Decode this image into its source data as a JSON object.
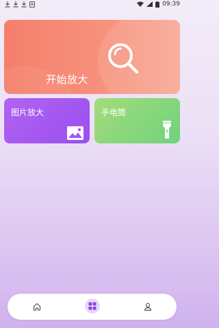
{
  "status_bar": {
    "time": "09:39",
    "icons": [
      "download-icon",
      "download-icon",
      "download-icon",
      "app-notification-icon"
    ]
  },
  "cards": {
    "start_zoom": {
      "label": "开始放大",
      "icon": "magnifier-icon"
    },
    "image_zoom": {
      "label": "图片放大",
      "icon": "image-icon"
    },
    "flashlight": {
      "label": "手电筒",
      "icon": "flashlight-icon"
    }
  },
  "nav": {
    "items": [
      {
        "name": "home",
        "icon": "home-icon",
        "active": false
      },
      {
        "name": "apps",
        "icon": "grid-icon",
        "active": true
      },
      {
        "name": "profile",
        "icon": "user-icon",
        "active": false
      }
    ],
    "accent": "#8e3fe0"
  },
  "colors": {
    "main_card": "#f58a74",
    "image_card": "#a656f0",
    "flashlight_card": "#84d57c"
  }
}
